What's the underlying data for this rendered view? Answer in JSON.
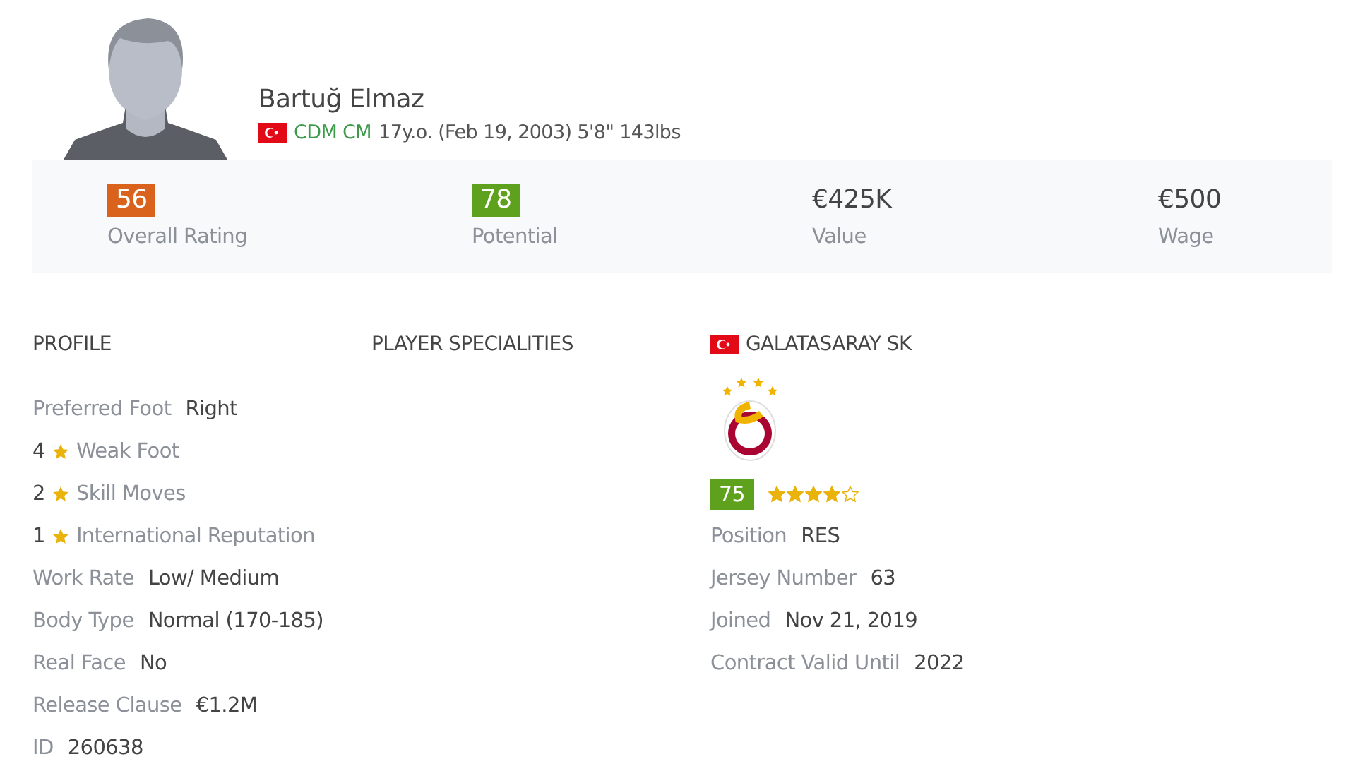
{
  "player": {
    "name": "Bartuğ Elmaz",
    "positions": "CDM CM",
    "info": "17y.o. (Feb 19, 2003) 5'8\" 143lbs"
  },
  "stats": [
    {
      "value": "56",
      "label": "Overall Rating",
      "kind": "badge",
      "color": "#d9621c"
    },
    {
      "value": "78",
      "label": "Potential",
      "kind": "badge",
      "color": "#5ea11c"
    },
    {
      "value": "€425K",
      "label": "Value",
      "kind": "plain"
    },
    {
      "value": "€500",
      "label": "Wage",
      "kind": "plain"
    }
  ],
  "profile": {
    "title": "PROFILE",
    "rows": [
      {
        "kind": "pair",
        "label": "Preferred Foot",
        "value": "Right"
      },
      {
        "kind": "star",
        "value": "4",
        "label": "Weak Foot"
      },
      {
        "kind": "star",
        "value": "2",
        "label": "Skill Moves"
      },
      {
        "kind": "star",
        "value": "1",
        "label": "International Reputation"
      },
      {
        "kind": "pair",
        "label": "Work Rate",
        "value": "Low/ Medium"
      },
      {
        "kind": "pair",
        "label": "Body Type",
        "value": "Normal (170-185)"
      },
      {
        "kind": "pair",
        "label": "Real Face",
        "value": "No"
      },
      {
        "kind": "pair",
        "label": "Release Clause",
        "value": "€1.2M"
      },
      {
        "kind": "pair",
        "label": "ID",
        "value": "260638"
      }
    ]
  },
  "specialities": {
    "title": "PLAYER SPECIALITIES"
  },
  "club": {
    "name": "GALATASARAY SK",
    "rating": {
      "value": "75",
      "color": "#5ea11c"
    },
    "stars": 4,
    "rows": [
      {
        "label": "Position",
        "value": "RES"
      },
      {
        "label": "Jersey Number",
        "value": "63"
      },
      {
        "label": "Joined",
        "value": "Nov 21, 2019"
      },
      {
        "label": "Contract Valid Until",
        "value": "2022"
      }
    ]
  }
}
